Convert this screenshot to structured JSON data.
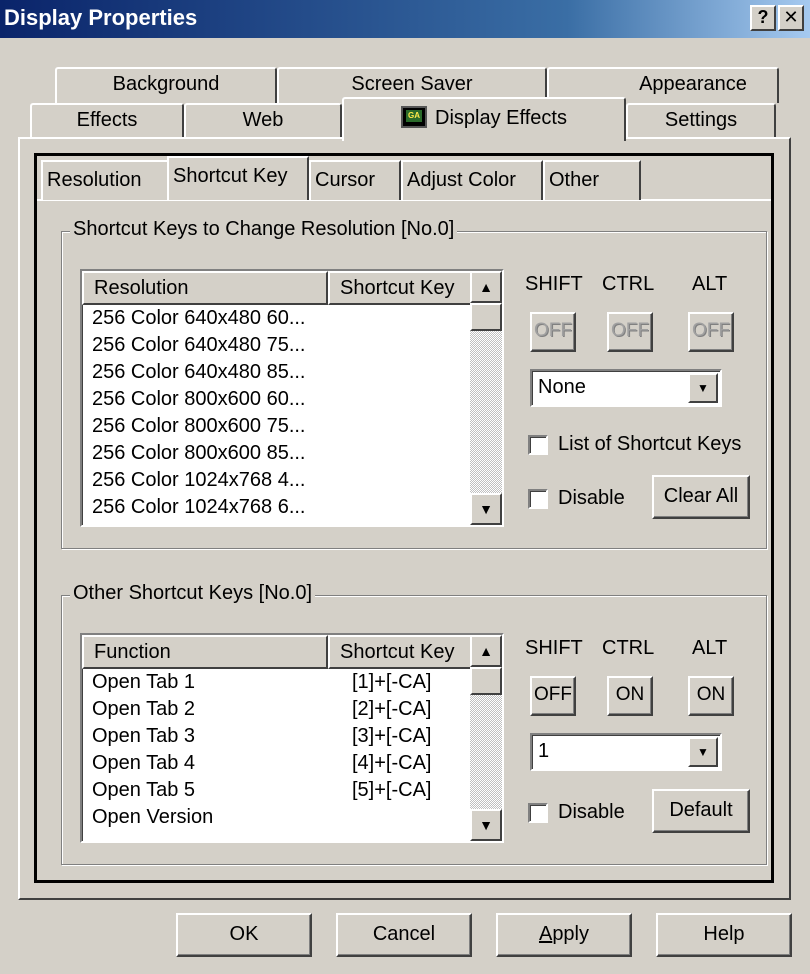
{
  "window": {
    "title": "Display Properties",
    "help_label": "?",
    "close_label": "✕"
  },
  "outer_tabs": {
    "row1": [
      "Background",
      "Screen Saver",
      "Appearance"
    ],
    "row2": [
      "Effects",
      "Web",
      "Display Effects",
      "Settings"
    ],
    "selected": "Display Effects"
  },
  "inner_tabs": {
    "items": [
      "Resolution",
      "Shortcut Key",
      "Cursor",
      "Adjust Color",
      "Other"
    ],
    "selected": "Shortcut Key"
  },
  "resolution_group": {
    "title": "Shortcut Keys to Change Resolution [No.0]",
    "columns": [
      "Resolution",
      "Shortcut Key"
    ],
    "rows": [
      "256 Color 640x480 60...",
      "256 Color 640x480 75...",
      "256 Color 640x480 85...",
      "256 Color 800x600 60...",
      "256 Color 800x600 75...",
      "256 Color 800x600 85...",
      "256 Color 1024x768 4...",
      "256 Color 1024x768 6..."
    ],
    "modifier_labels": [
      "SHIFT",
      "CTRL",
      "ALT"
    ],
    "modifier_values": [
      "OFF",
      "OFF",
      "OFF"
    ],
    "key_select": "None",
    "list_checkbox_label": "List of Shortcut Keys",
    "disable_label": "Disable",
    "clear_all_label": "Clear All"
  },
  "other_group": {
    "title": "Other Shortcut Keys [No.0]",
    "columns": [
      "Function",
      "Shortcut Key"
    ],
    "rows": [
      {
        "function": "Open Tab 1",
        "key": "[1]+[-CA]"
      },
      {
        "function": "Open Tab 2",
        "key": "[2]+[-CA]"
      },
      {
        "function": "Open Tab 3",
        "key": "[3]+[-CA]"
      },
      {
        "function": "Open Tab 4",
        "key": "[4]+[-CA]"
      },
      {
        "function": "Open Tab 5",
        "key": "[5]+[-CA]"
      },
      {
        "function": "Open Version",
        "key": ""
      }
    ],
    "modifier_labels": [
      "SHIFT",
      "CTRL",
      "ALT"
    ],
    "modifier_values": [
      "OFF",
      "ON",
      "ON"
    ],
    "key_select": "1",
    "disable_label": "Disable",
    "default_label": "Default"
  },
  "buttons": {
    "ok": "OK",
    "cancel": "Cancel",
    "apply_first": "A",
    "apply_rest": "pply",
    "help": "Help"
  }
}
